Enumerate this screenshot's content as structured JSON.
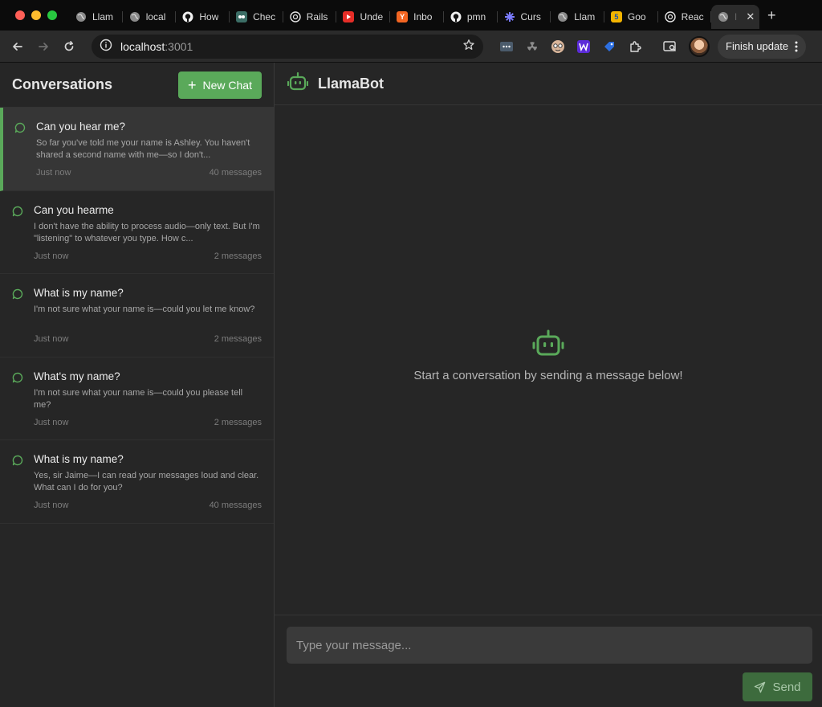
{
  "browser": {
    "tabs": [
      {
        "title": "Llam",
        "icon": "globe-icon"
      },
      {
        "title": "local",
        "icon": "globe-icon"
      },
      {
        "title": "How",
        "icon": "github-icon"
      },
      {
        "title": "Chec",
        "icon": "extension-icon"
      },
      {
        "title": "Rails",
        "icon": "openai-icon"
      },
      {
        "title": "Unde",
        "icon": "youtube-icon"
      },
      {
        "title": "Inbo",
        "icon": "ycombinator-icon"
      },
      {
        "title": "pmn",
        "icon": "github-icon"
      },
      {
        "title": "Curs",
        "icon": "cursor-icon"
      },
      {
        "title": "Llam",
        "icon": "globe-icon"
      },
      {
        "title": "Goo",
        "icon": "google-icon"
      },
      {
        "title": "Reac",
        "icon": "openai-icon"
      }
    ],
    "active_tab": {
      "title": "l",
      "icon": "globe-icon"
    },
    "url_host": "localhost",
    "url_port": ":3001",
    "finish_update_label": "Finish update",
    "ycombinator_glyph": "Y",
    "google_glyph": "5"
  },
  "sidebar": {
    "title": "Conversations",
    "new_chat_label": "New Chat",
    "conversations": [
      {
        "title": "Can you hear me?",
        "preview": "So far you've told me your name is Ashley. You haven't shared a second name with me—so I don't...",
        "time": "Just now",
        "count": "40 messages"
      },
      {
        "title": "Can you hearme",
        "preview": "I don't have the ability to process audio—only text. But I'm \"listening\" to whatever you type. How c...",
        "time": "Just now",
        "count": "2 messages"
      },
      {
        "title": "What is my name?",
        "preview": "I'm not sure what your name is—could you let me know?",
        "time": "Just now",
        "count": "2 messages"
      },
      {
        "title": "What's my name?",
        "preview": "I'm not sure what your name is—could you please tell me?",
        "time": "Just now",
        "count": "2 messages"
      },
      {
        "title": "What is my name?",
        "preview": "Yes, sir Jaime—I can read your messages loud and clear. What can I do for you?",
        "time": "Just now",
        "count": "40 messages"
      }
    ]
  },
  "main": {
    "title": "LlamaBot",
    "empty_text": "Start a conversation by sending a message below!",
    "input_placeholder": "Type your message...",
    "send_label": "Send"
  },
  "colors": {
    "accent": "#5aa95a",
    "send_bg": "#3d6b3d",
    "background": "#262626"
  }
}
